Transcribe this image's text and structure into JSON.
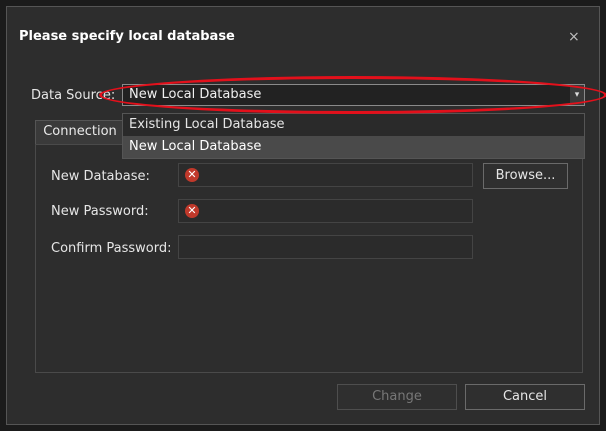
{
  "dialog": {
    "title": "Please specify local database",
    "close_glyph": "×"
  },
  "data_source": {
    "label": "Data Source:",
    "selected": "New Local Database",
    "arrow_glyph": "▾",
    "options": [
      "Existing Local Database",
      "New Local Database"
    ]
  },
  "tab": {
    "label": "Connection"
  },
  "fields": {
    "new_database": {
      "label": "New Database:",
      "value": "",
      "error_glyph": "✕"
    },
    "new_password": {
      "label": "New Password:",
      "value": "",
      "error_glyph": "✕"
    },
    "confirm_password": {
      "label": "Confirm Password:",
      "value": ""
    }
  },
  "buttons": {
    "browse": "Browse...",
    "change": "Change",
    "cancel": "Cancel"
  },
  "colors": {
    "annotation": "#e3101b",
    "error": "#c0392b"
  }
}
